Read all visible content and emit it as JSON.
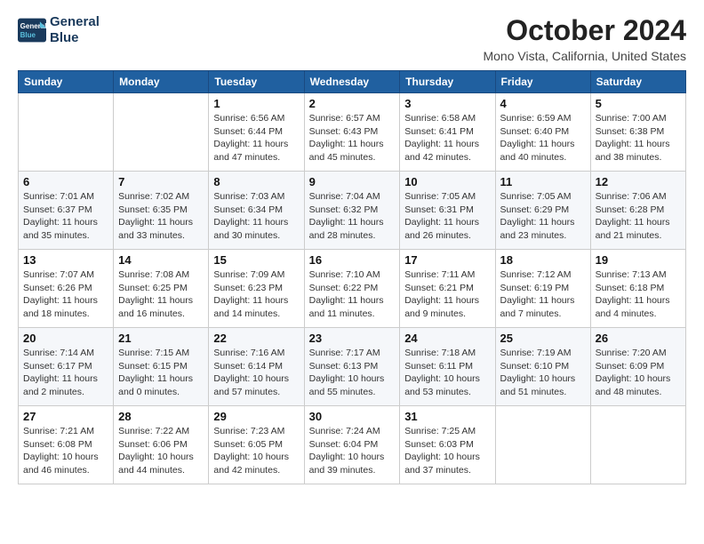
{
  "logo": {
    "line1": "General",
    "line2": "Blue"
  },
  "title": "October 2024",
  "location": "Mono Vista, California, United States",
  "days_of_week": [
    "Sunday",
    "Monday",
    "Tuesday",
    "Wednesday",
    "Thursday",
    "Friday",
    "Saturday"
  ],
  "weeks": [
    [
      {
        "day": "",
        "detail": ""
      },
      {
        "day": "",
        "detail": ""
      },
      {
        "day": "1",
        "detail": "Sunrise: 6:56 AM\nSunset: 6:44 PM\nDaylight: 11 hours and 47 minutes."
      },
      {
        "day": "2",
        "detail": "Sunrise: 6:57 AM\nSunset: 6:43 PM\nDaylight: 11 hours and 45 minutes."
      },
      {
        "day": "3",
        "detail": "Sunrise: 6:58 AM\nSunset: 6:41 PM\nDaylight: 11 hours and 42 minutes."
      },
      {
        "day": "4",
        "detail": "Sunrise: 6:59 AM\nSunset: 6:40 PM\nDaylight: 11 hours and 40 minutes."
      },
      {
        "day": "5",
        "detail": "Sunrise: 7:00 AM\nSunset: 6:38 PM\nDaylight: 11 hours and 38 minutes."
      }
    ],
    [
      {
        "day": "6",
        "detail": "Sunrise: 7:01 AM\nSunset: 6:37 PM\nDaylight: 11 hours and 35 minutes."
      },
      {
        "day": "7",
        "detail": "Sunrise: 7:02 AM\nSunset: 6:35 PM\nDaylight: 11 hours and 33 minutes."
      },
      {
        "day": "8",
        "detail": "Sunrise: 7:03 AM\nSunset: 6:34 PM\nDaylight: 11 hours and 30 minutes."
      },
      {
        "day": "9",
        "detail": "Sunrise: 7:04 AM\nSunset: 6:32 PM\nDaylight: 11 hours and 28 minutes."
      },
      {
        "day": "10",
        "detail": "Sunrise: 7:05 AM\nSunset: 6:31 PM\nDaylight: 11 hours and 26 minutes."
      },
      {
        "day": "11",
        "detail": "Sunrise: 7:05 AM\nSunset: 6:29 PM\nDaylight: 11 hours and 23 minutes."
      },
      {
        "day": "12",
        "detail": "Sunrise: 7:06 AM\nSunset: 6:28 PM\nDaylight: 11 hours and 21 minutes."
      }
    ],
    [
      {
        "day": "13",
        "detail": "Sunrise: 7:07 AM\nSunset: 6:26 PM\nDaylight: 11 hours and 18 minutes."
      },
      {
        "day": "14",
        "detail": "Sunrise: 7:08 AM\nSunset: 6:25 PM\nDaylight: 11 hours and 16 minutes."
      },
      {
        "day": "15",
        "detail": "Sunrise: 7:09 AM\nSunset: 6:23 PM\nDaylight: 11 hours and 14 minutes."
      },
      {
        "day": "16",
        "detail": "Sunrise: 7:10 AM\nSunset: 6:22 PM\nDaylight: 11 hours and 11 minutes."
      },
      {
        "day": "17",
        "detail": "Sunrise: 7:11 AM\nSunset: 6:21 PM\nDaylight: 11 hours and 9 minutes."
      },
      {
        "day": "18",
        "detail": "Sunrise: 7:12 AM\nSunset: 6:19 PM\nDaylight: 11 hours and 7 minutes."
      },
      {
        "day": "19",
        "detail": "Sunrise: 7:13 AM\nSunset: 6:18 PM\nDaylight: 11 hours and 4 minutes."
      }
    ],
    [
      {
        "day": "20",
        "detail": "Sunrise: 7:14 AM\nSunset: 6:17 PM\nDaylight: 11 hours and 2 minutes."
      },
      {
        "day": "21",
        "detail": "Sunrise: 7:15 AM\nSunset: 6:15 PM\nDaylight: 11 hours and 0 minutes."
      },
      {
        "day": "22",
        "detail": "Sunrise: 7:16 AM\nSunset: 6:14 PM\nDaylight: 10 hours and 57 minutes."
      },
      {
        "day": "23",
        "detail": "Sunrise: 7:17 AM\nSunset: 6:13 PM\nDaylight: 10 hours and 55 minutes."
      },
      {
        "day": "24",
        "detail": "Sunrise: 7:18 AM\nSunset: 6:11 PM\nDaylight: 10 hours and 53 minutes."
      },
      {
        "day": "25",
        "detail": "Sunrise: 7:19 AM\nSunset: 6:10 PM\nDaylight: 10 hours and 51 minutes."
      },
      {
        "day": "26",
        "detail": "Sunrise: 7:20 AM\nSunset: 6:09 PM\nDaylight: 10 hours and 48 minutes."
      }
    ],
    [
      {
        "day": "27",
        "detail": "Sunrise: 7:21 AM\nSunset: 6:08 PM\nDaylight: 10 hours and 46 minutes."
      },
      {
        "day": "28",
        "detail": "Sunrise: 7:22 AM\nSunset: 6:06 PM\nDaylight: 10 hours and 44 minutes."
      },
      {
        "day": "29",
        "detail": "Sunrise: 7:23 AM\nSunset: 6:05 PM\nDaylight: 10 hours and 42 minutes."
      },
      {
        "day": "30",
        "detail": "Sunrise: 7:24 AM\nSunset: 6:04 PM\nDaylight: 10 hours and 39 minutes."
      },
      {
        "day": "31",
        "detail": "Sunrise: 7:25 AM\nSunset: 6:03 PM\nDaylight: 10 hours and 37 minutes."
      },
      {
        "day": "",
        "detail": ""
      },
      {
        "day": "",
        "detail": ""
      }
    ]
  ]
}
